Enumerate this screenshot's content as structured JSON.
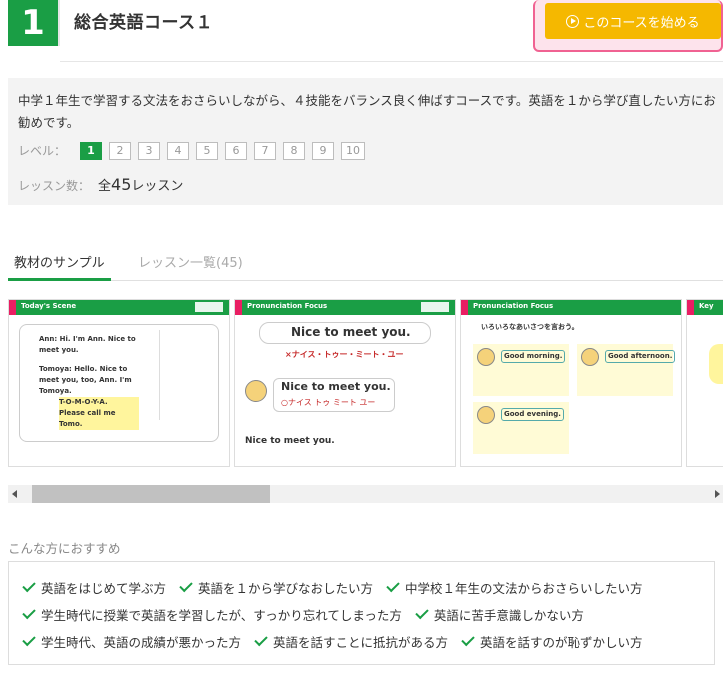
{
  "course": {
    "number": "1",
    "title": "総合英語コース１",
    "start_label": "このコースを始める"
  },
  "description": "中学１年生で学習する文法をおさらいしながら、４技能をバランス良く伸ばすコースです。英語を１から学び直したい方にお勧めです。",
  "level": {
    "label": "レベル：",
    "items": [
      "1",
      "2",
      "3",
      "4",
      "5",
      "6",
      "7",
      "8",
      "9",
      "10"
    ],
    "active": "1"
  },
  "lessons": {
    "label": "レッスン数：",
    "prefix": "全",
    "count": "45",
    "suffix": "レッスン"
  },
  "tabs": [
    {
      "label": "教材のサンプル",
      "active": true
    },
    {
      "label": "レッスン一覧(45)",
      "active": false
    }
  ],
  "slides": [
    {
      "title": "Today's Scene",
      "lines": [
        "Ann: Hi. I'm Ann. Nice to meet you.",
        "Tomoya: Hello. Nice to meet you, too, Ann. I'm Tomoya.",
        "T-O-M-O-Y-A.",
        "Please call me Tomo."
      ]
    },
    {
      "title": "Pronunciation Focus",
      "lines": [
        "Nice to meet you.",
        "×ナイス・トゥー・ミート・ユー",
        "Nice to meet you.",
        "○ナイス トゥ ミート ユー",
        "Nice to meet you."
      ]
    },
    {
      "title": "Pronunciation Focus",
      "lines": [
        "いろいろなあいさつを言おう。",
        "Good morning.",
        "Good afternoon.",
        "Good evening."
      ]
    },
    {
      "title": "Key",
      "lines": []
    }
  ],
  "recommend": {
    "title": "こんな方におすすめ",
    "rows": [
      [
        "英語をはじめて学ぶ方",
        "英語を１から学びなおしたい方",
        "中学校１年生の文法からおさらいしたい方"
      ],
      [
        "学生時代に授業で英語を学習したが、すっかり忘れてしまった方",
        "英語に苦手意識しかない方"
      ],
      [
        "学生時代、英語の成績が悪かった方",
        "英語を話すことに抵抗がある方",
        "英語を話すのが恥ずかしい方"
      ]
    ]
  },
  "colors": {
    "brand_green": "#1a9e45",
    "start_yellow": "#f5b800",
    "highlight_pink": "#f06292"
  }
}
